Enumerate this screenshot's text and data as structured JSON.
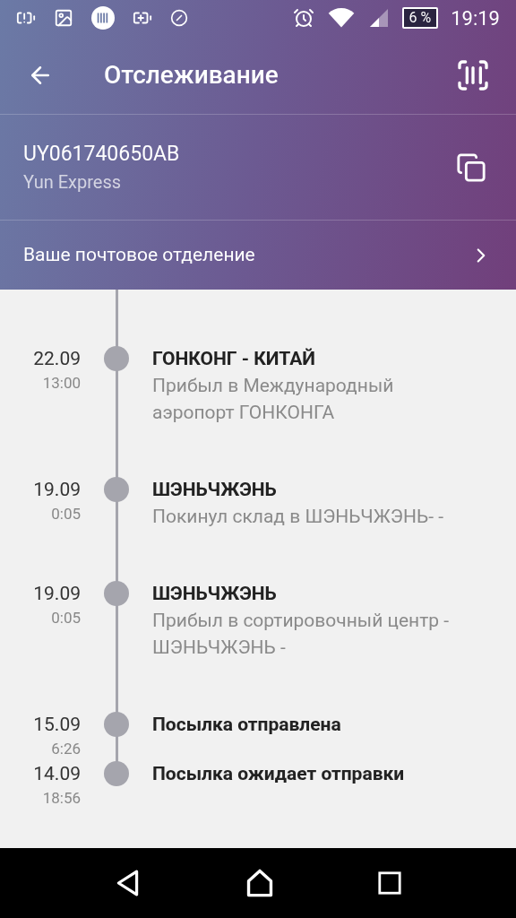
{
  "status_bar": {
    "battery": "6 %",
    "time": "19:19"
  },
  "toolbar": {
    "title": "Отслеживание"
  },
  "parcel": {
    "tracking_number": "UY061740650AB",
    "carrier": "Yun Express"
  },
  "post_office": {
    "label": "Ваше почтовое отделение"
  },
  "events": [
    {
      "date": "22.09",
      "time": "13:00",
      "title": "ГОНКОНГ - КИТАЙ",
      "description": "Прибыл в Международный аэропорт ГОНКОНГА"
    },
    {
      "date": "19.09",
      "time": "0:05",
      "title": "ШЭНЬЧЖЭНЬ",
      "description": "Покинул склад в ШЭНЬЧЖЭНЬ- -"
    },
    {
      "date": "19.09",
      "time": "0:05",
      "title": "ШЭНЬЧЖЭНЬ",
      "description": "Прибыл в сортировочный центр - ШЭНЬЧЖЭНЬ -"
    },
    {
      "date": "15.09",
      "time": "6:26",
      "title": "Посылка отправлена"
    },
    {
      "date": "14.09",
      "time": "18:56",
      "title": "Посылка ожидает отправки"
    }
  ]
}
